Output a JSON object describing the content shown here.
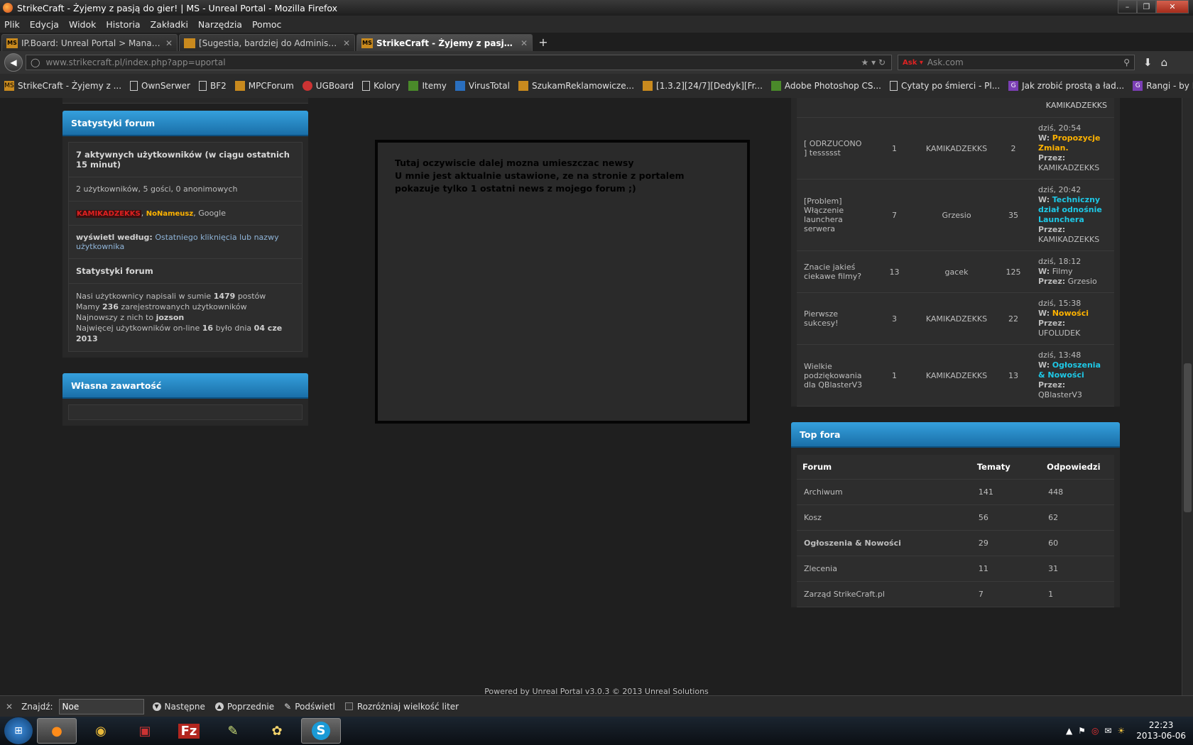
{
  "window": {
    "title": "StrikeCraft - Żyjemy z pasją do gier! | MS - Unreal Portal - Mozilla Firefox"
  },
  "menu": [
    "Plik",
    "Edycja",
    "Widok",
    "Historia",
    "Zakładki",
    "Narzędzia",
    "Pomoc"
  ],
  "tabs": [
    {
      "label": "IP.Board: Unreal Portal > Manage Un..."
    },
    {
      "label": "[Sugestia, bardziej do Administrator..."
    },
    {
      "label": "StrikeCraft - Żyjemy z pasją do gie..."
    }
  ],
  "url": "www.strikecraft.pl/index.php?app=uportal",
  "search_placeholder": "Ask.com",
  "bookmarks": [
    "StrikeCraft - Żyjemy z ...",
    "OwnSerwer",
    "BF2",
    "MPCForum",
    "UGBoard",
    "Kolory",
    "Itemy",
    "VirusTotal",
    "SzukamReklamowicze...",
    "[1.3.2][24/7][Dedyk][Fr...",
    "Adobe Photoshop CS...",
    "Cytaty po śmierci - Pl...",
    "Jak zrobić prostą a ład...",
    "Rangi - by Broniu - Gr..."
  ],
  "top_cut": "KAMIKADZEKKS",
  "stats": {
    "header": "Statystyki forum",
    "active_title": "7 aktywnych użytkowników (w ciągu ostatnich 15 minut)",
    "active_breakdown": "2 użytkowników, 5 gości, 0 anonimowych",
    "user1": "KAMIKADZEKKS",
    "user2": "NoNameusz",
    "user3": "Google",
    "sort_label": "wyświetl według:",
    "sort_link": "Ostatniego kliknięcia lub nazwy użytkownika",
    "stats_title": "Statystyki forum",
    "posts_pre": "Nasi użytkownicy napisali w sumie",
    "posts_count": "1479",
    "posts_post": "postów",
    "members_pre": "Mamy",
    "members_count": "236",
    "members_post": "zarejestrowanych użytkowników",
    "newest_pre": "Najnowszy z nich to",
    "newest_user": "jozson",
    "record_pre": "Najwięcej użytkowników on-line",
    "record_count": "16",
    "record_mid": "było dnia",
    "record_date": "04 cze 2013"
  },
  "own_content": {
    "header": "Własna zawartość"
  },
  "news_box": {
    "line1": "Tutaj oczywiscie dalej mozna umieszczac newsy",
    "line2": "U mnie jest aktualnie ustawione, ze na stronie z portalem pokazuje tylko 1 ostatni news z mojego forum ;)"
  },
  "topics": [
    {
      "title": "[ ODRZUCONO ] tessssst",
      "replies": "1",
      "author": "KAMIKADZEKKS",
      "views": "2",
      "time": "dziś, 20:54",
      "w_label": "W:",
      "forum": "Propozycje Zmian.",
      "forum_color": "yel",
      "by_label": "Przez:",
      "by": "KAMIKADZEKKS"
    },
    {
      "title": "[Problem] Włączenie launchera serwera",
      "replies": "7",
      "author": "Grzesio",
      "views": "35",
      "time": "dziś, 20:42",
      "w_label": "W:",
      "forum": "Techniczny dział odnośnie Launchera",
      "forum_color": "cyn",
      "by_label": "Przez:",
      "by": "KAMIKADZEKKS"
    },
    {
      "title": "Znacie jakieś ciekawe filmy?",
      "replies": "13",
      "author": "gacek",
      "views": "125",
      "time": "dziś, 18:12",
      "w_label": "W:",
      "forum": "Filmy",
      "forum_color": "",
      "by_label": "Przez:",
      "by": "Grzesio"
    },
    {
      "title": "Pierwsze sukcesy!",
      "replies": "3",
      "author": "KAMIKADZEKKS",
      "views": "22",
      "time": "dziś, 15:38",
      "w_label": "W:",
      "forum": "Nowości",
      "forum_color": "yel",
      "by_label": "Przez:",
      "by": "UFOLUDEK"
    },
    {
      "title": "Wielkie podziękowania dla QBlasterV3",
      "replies": "1",
      "author": "KAMIKADZEKKS",
      "views": "13",
      "time": "dziś, 13:48",
      "w_label": "W:",
      "forum": "Ogłoszenia & Nowości",
      "forum_color": "cyn",
      "by_label": "Przez:",
      "by": "QBlasterV3"
    }
  ],
  "top_fora": {
    "header": "Top fora",
    "col_forum": "Forum",
    "col_topics": "Tematy",
    "col_replies": "Odpowiedzi",
    "rows": [
      {
        "name": "Archiwum",
        "topics": "141",
        "replies": "448"
      },
      {
        "name": "Kosz",
        "topics": "56",
        "replies": "62"
      },
      {
        "name": "Ogłoszenia & Nowości",
        "topics": "29",
        "replies": "60"
      },
      {
        "name": "Zlecenia",
        "topics": "11",
        "replies": "31"
      },
      {
        "name": "Zarząd StrikeCraft.pl",
        "topics": "7",
        "replies": "1"
      }
    ]
  },
  "footer": {
    "text": "Powered by Unreal Portal v3.0.3 © 2013 Unreal Solutions"
  },
  "findbar": {
    "label": "Znajdź:",
    "value": "Noe",
    "next": "Następne",
    "prev": "Poprzednie",
    "highlight": "Podświetl",
    "match_case": "Rozróżniaj wielkość liter"
  },
  "clock": {
    "time": "22:23",
    "date": "2013-06-06"
  }
}
